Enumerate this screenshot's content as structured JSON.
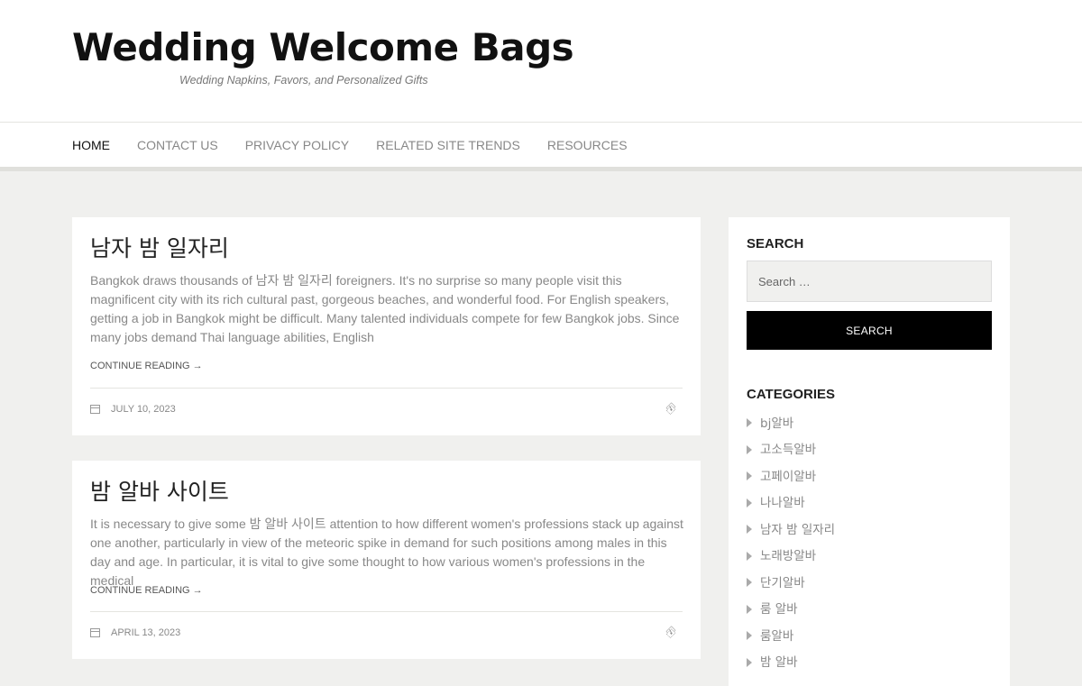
{
  "header": {
    "title": "Wedding Welcome Bags",
    "description": "Wedding Napkins, Favors, and Personalized Gifts"
  },
  "nav": {
    "items": [
      {
        "label": "HOME",
        "active": true
      },
      {
        "label": "CONTACT US",
        "active": false
      },
      {
        "label": "PRIVACY POLICY",
        "active": false
      },
      {
        "label": "RELATED SITE TRENDS",
        "active": false
      },
      {
        "label": "RESOURCES",
        "active": false
      }
    ]
  },
  "posts": [
    {
      "title": "남자 밤 일자리",
      "excerpt": "Bangkok draws thousands of 남자 밤 일자리 foreigners. It's no surprise so many people visit this magnificent city with its rich cultural past, gorgeous beaches, and wonderful food. For English speakers, getting a job in Bangkok might be difficult. Many talented individuals compete for few Bangkok jobs. Since many jobs demand Thai language abilities, English",
      "continue_label": "CONTINUE READING →",
      "date": "JULY 10, 2023"
    },
    {
      "title": "밤 알바 사이트",
      "excerpt": "It is necessary to give some 밤 알바 사이트 attention to how different women's professions stack up against one another, particularly in view of the meteoric spike in demand for such positions among males in this day and age. In particular, it is vital to give some thought to how various women's professions in the medical",
      "continue_label": "CONTINUE READING →",
      "date": "APRIL 13, 2023"
    }
  ],
  "sidebar": {
    "search": {
      "title": "SEARCH",
      "placeholder": "Search …",
      "button_label": "SEARCH"
    },
    "categories": {
      "title": "CATEGORIES",
      "items": [
        "bj알바",
        "고소득알바",
        "고페이알바",
        "나나알바",
        "남자 밤 일자리",
        "노래방알바",
        "단기알바",
        "룸 알바",
        "룸알바",
        "밤 알바"
      ]
    }
  },
  "icons": {
    "date": "calendar-icon",
    "format": "paperclip-icon",
    "category_bullet": "triangle-right-icon"
  },
  "colors": {
    "background": "#f0f0ee",
    "button": "#000000",
    "title": "#111111"
  }
}
